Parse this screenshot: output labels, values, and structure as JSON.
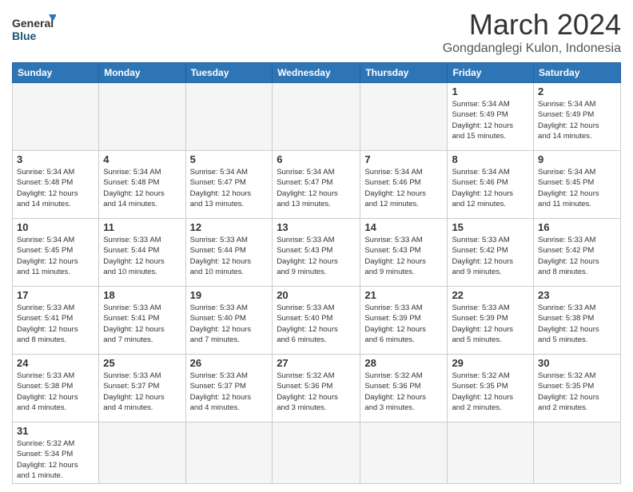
{
  "logo": {
    "text_general": "General",
    "text_blue": "Blue"
  },
  "title": "March 2024",
  "location": "Gongdanglegi Kulon, Indonesia",
  "weekdays": [
    "Sunday",
    "Monday",
    "Tuesday",
    "Wednesday",
    "Thursday",
    "Friday",
    "Saturday"
  ],
  "weeks": [
    [
      {
        "day": "",
        "info": ""
      },
      {
        "day": "",
        "info": ""
      },
      {
        "day": "",
        "info": ""
      },
      {
        "day": "",
        "info": ""
      },
      {
        "day": "",
        "info": ""
      },
      {
        "day": "1",
        "info": "Sunrise: 5:34 AM\nSunset: 5:49 PM\nDaylight: 12 hours\nand 15 minutes."
      },
      {
        "day": "2",
        "info": "Sunrise: 5:34 AM\nSunset: 5:49 PM\nDaylight: 12 hours\nand 14 minutes."
      }
    ],
    [
      {
        "day": "3",
        "info": "Sunrise: 5:34 AM\nSunset: 5:48 PM\nDaylight: 12 hours\nand 14 minutes."
      },
      {
        "day": "4",
        "info": "Sunrise: 5:34 AM\nSunset: 5:48 PM\nDaylight: 12 hours\nand 14 minutes."
      },
      {
        "day": "5",
        "info": "Sunrise: 5:34 AM\nSunset: 5:47 PM\nDaylight: 12 hours\nand 13 minutes."
      },
      {
        "day": "6",
        "info": "Sunrise: 5:34 AM\nSunset: 5:47 PM\nDaylight: 12 hours\nand 13 minutes."
      },
      {
        "day": "7",
        "info": "Sunrise: 5:34 AM\nSunset: 5:46 PM\nDaylight: 12 hours\nand 12 minutes."
      },
      {
        "day": "8",
        "info": "Sunrise: 5:34 AM\nSunset: 5:46 PM\nDaylight: 12 hours\nand 12 minutes."
      },
      {
        "day": "9",
        "info": "Sunrise: 5:34 AM\nSunset: 5:45 PM\nDaylight: 12 hours\nand 11 minutes."
      }
    ],
    [
      {
        "day": "10",
        "info": "Sunrise: 5:34 AM\nSunset: 5:45 PM\nDaylight: 12 hours\nand 11 minutes."
      },
      {
        "day": "11",
        "info": "Sunrise: 5:33 AM\nSunset: 5:44 PM\nDaylight: 12 hours\nand 10 minutes."
      },
      {
        "day": "12",
        "info": "Sunrise: 5:33 AM\nSunset: 5:44 PM\nDaylight: 12 hours\nand 10 minutes."
      },
      {
        "day": "13",
        "info": "Sunrise: 5:33 AM\nSunset: 5:43 PM\nDaylight: 12 hours\nand 9 minutes."
      },
      {
        "day": "14",
        "info": "Sunrise: 5:33 AM\nSunset: 5:43 PM\nDaylight: 12 hours\nand 9 minutes."
      },
      {
        "day": "15",
        "info": "Sunrise: 5:33 AM\nSunset: 5:42 PM\nDaylight: 12 hours\nand 9 minutes."
      },
      {
        "day": "16",
        "info": "Sunrise: 5:33 AM\nSunset: 5:42 PM\nDaylight: 12 hours\nand 8 minutes."
      }
    ],
    [
      {
        "day": "17",
        "info": "Sunrise: 5:33 AM\nSunset: 5:41 PM\nDaylight: 12 hours\nand 8 minutes."
      },
      {
        "day": "18",
        "info": "Sunrise: 5:33 AM\nSunset: 5:41 PM\nDaylight: 12 hours\nand 7 minutes."
      },
      {
        "day": "19",
        "info": "Sunrise: 5:33 AM\nSunset: 5:40 PM\nDaylight: 12 hours\nand 7 minutes."
      },
      {
        "day": "20",
        "info": "Sunrise: 5:33 AM\nSunset: 5:40 PM\nDaylight: 12 hours\nand 6 minutes."
      },
      {
        "day": "21",
        "info": "Sunrise: 5:33 AM\nSunset: 5:39 PM\nDaylight: 12 hours\nand 6 minutes."
      },
      {
        "day": "22",
        "info": "Sunrise: 5:33 AM\nSunset: 5:39 PM\nDaylight: 12 hours\nand 5 minutes."
      },
      {
        "day": "23",
        "info": "Sunrise: 5:33 AM\nSunset: 5:38 PM\nDaylight: 12 hours\nand 5 minutes."
      }
    ],
    [
      {
        "day": "24",
        "info": "Sunrise: 5:33 AM\nSunset: 5:38 PM\nDaylight: 12 hours\nand 4 minutes."
      },
      {
        "day": "25",
        "info": "Sunrise: 5:33 AM\nSunset: 5:37 PM\nDaylight: 12 hours\nand 4 minutes."
      },
      {
        "day": "26",
        "info": "Sunrise: 5:33 AM\nSunset: 5:37 PM\nDaylight: 12 hours\nand 4 minutes."
      },
      {
        "day": "27",
        "info": "Sunrise: 5:32 AM\nSunset: 5:36 PM\nDaylight: 12 hours\nand 3 minutes."
      },
      {
        "day": "28",
        "info": "Sunrise: 5:32 AM\nSunset: 5:36 PM\nDaylight: 12 hours\nand 3 minutes."
      },
      {
        "day": "29",
        "info": "Sunrise: 5:32 AM\nSunset: 5:35 PM\nDaylight: 12 hours\nand 2 minutes."
      },
      {
        "day": "30",
        "info": "Sunrise: 5:32 AM\nSunset: 5:35 PM\nDaylight: 12 hours\nand 2 minutes."
      }
    ],
    [
      {
        "day": "31",
        "info": "Sunrise: 5:32 AM\nSunset: 5:34 PM\nDaylight: 12 hours\nand 1 minute."
      },
      {
        "day": "",
        "info": ""
      },
      {
        "day": "",
        "info": ""
      },
      {
        "day": "",
        "info": ""
      },
      {
        "day": "",
        "info": ""
      },
      {
        "day": "",
        "info": ""
      },
      {
        "day": "",
        "info": ""
      }
    ]
  ]
}
